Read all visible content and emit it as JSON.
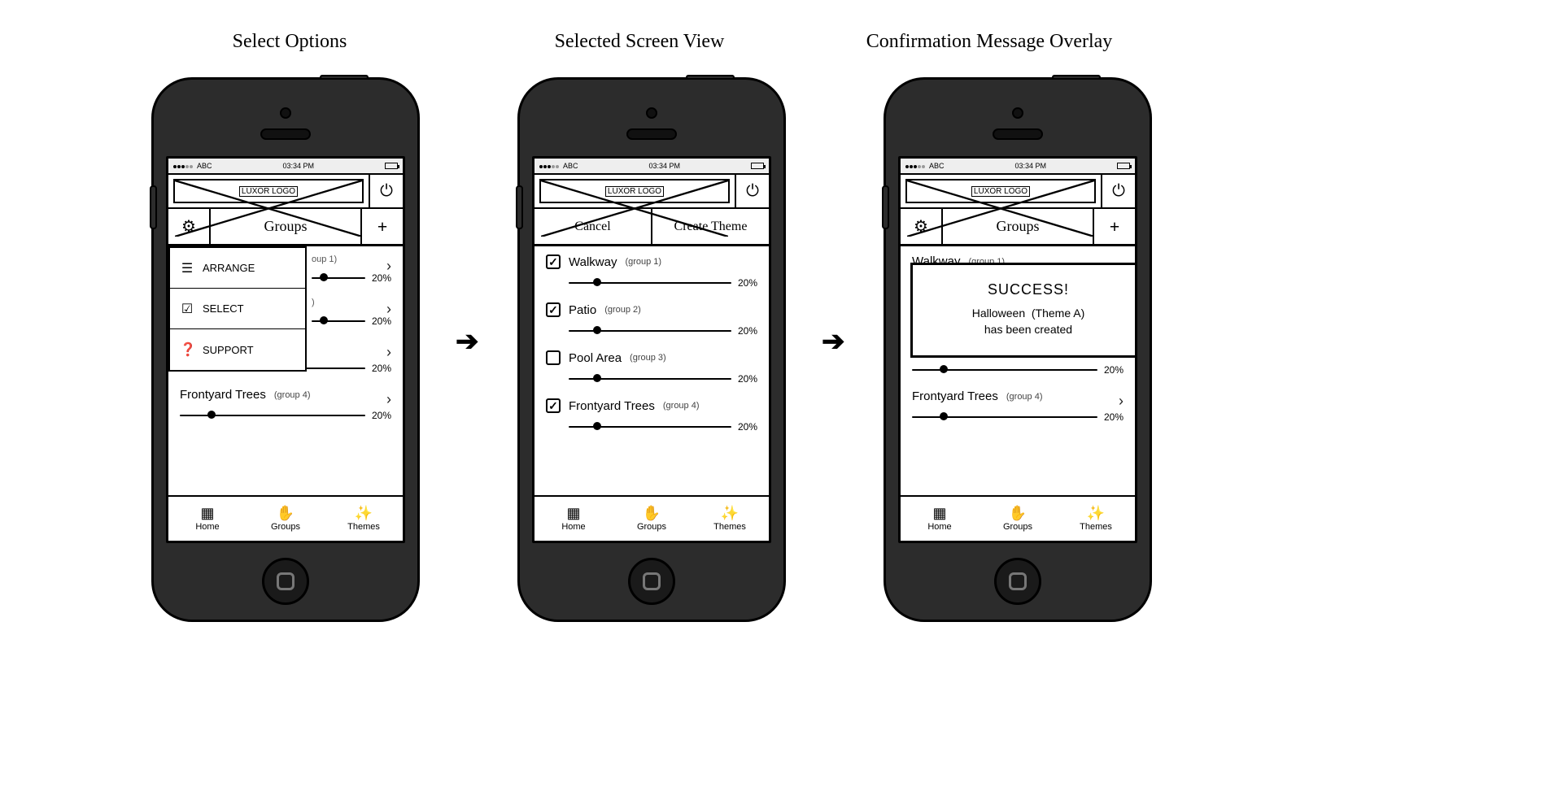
{
  "titles": {
    "s1": "Select Options",
    "s2": "Selected Screen View",
    "s3": "Confirmation Message Overlay"
  },
  "statusbar": {
    "carrier": "ABC",
    "time": "03:34 PM"
  },
  "header": {
    "logo_text": "LUXOR LOGO"
  },
  "toolbar": {
    "groups_title": "Groups",
    "cancel": "Cancel",
    "create_theme": "Create Theme"
  },
  "options_menu": {
    "arrange": "ARRANGE",
    "select": "SELECT",
    "support": "SUPPORT"
  },
  "groups": [
    {
      "name": "Walkway",
      "sub": "(group 1)",
      "pct": "20%",
      "knob": 15,
      "checked": true
    },
    {
      "name": "Patio",
      "sub": "(group 2)",
      "pct": "20%",
      "knob": 15,
      "checked": true
    },
    {
      "name": "Pool Area",
      "sub": "(group 3)",
      "pct": "20%",
      "knob": 15,
      "checked": false
    },
    {
      "name": "Frontyard Trees",
      "sub": "(group 4)",
      "pct": "20%",
      "knob": 15,
      "checked": true
    }
  ],
  "peek": {
    "row1_sub": "oup 1)",
    "row1_pct": "20%",
    "row2_sub": ")",
    "row2_pct": "20%"
  },
  "modal": {
    "title": "SUCCESS!",
    "line1a": "Halloween",
    "line1b": "(Theme A)",
    "line2": "has been created"
  },
  "tabs": {
    "home": "Home",
    "groups": "Groups",
    "themes": "Themes"
  }
}
